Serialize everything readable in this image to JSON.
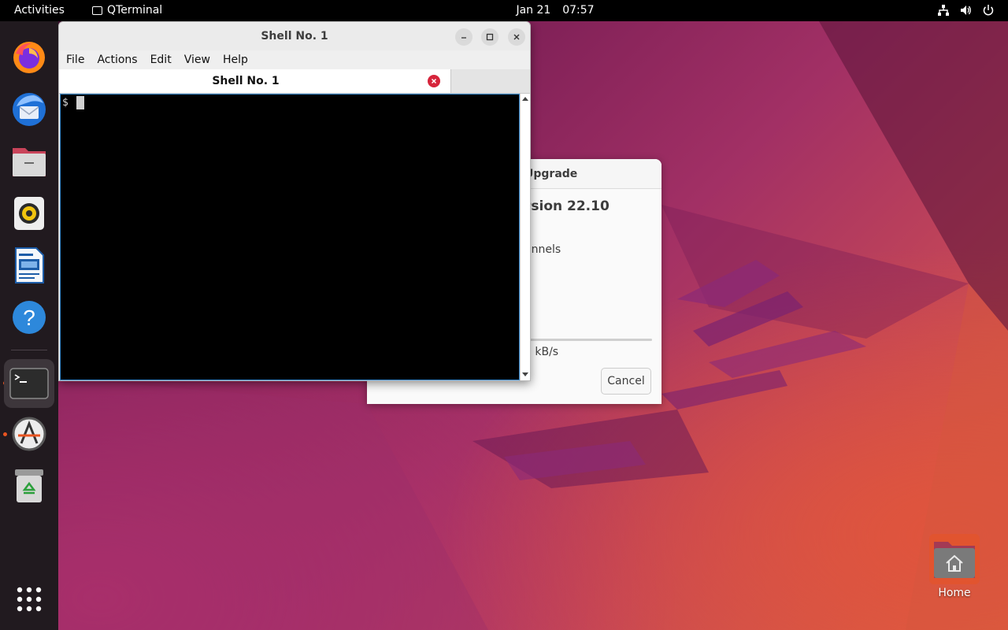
{
  "topbar": {
    "activities": "Activities",
    "app_name": "QTerminal",
    "date": "Jan 21",
    "time": "07:57",
    "tray_icons": [
      "network-icon",
      "volume-icon",
      "power-icon"
    ]
  },
  "dock": {
    "items": [
      {
        "name": "firefox",
        "icon": "firefox-icon",
        "running": false
      },
      {
        "name": "thunderbird",
        "icon": "thunderbird-icon",
        "running": false
      },
      {
        "name": "files",
        "icon": "folder-icon",
        "running": false
      },
      {
        "name": "rhythmbox",
        "icon": "speaker-icon",
        "running": false
      },
      {
        "name": "libreoffice-writer",
        "icon": "document-icon",
        "running": false
      },
      {
        "name": "help",
        "icon": "help-icon",
        "running": false
      },
      {
        "name": "terminal",
        "icon": "terminal-icon",
        "running": true,
        "active": true
      },
      {
        "name": "software-updater",
        "icon": "updater-icon",
        "running": true
      },
      {
        "name": "trash",
        "icon": "trash-icon",
        "running": false
      }
    ],
    "apps_grid_icon": "app-grid-icon"
  },
  "upgrade_dialog": {
    "title_fragment": "Upgrade",
    "version_fragment": "rsion 22.10",
    "channels_fragment": "annels",
    "r_fragment": "r",
    "speed_fragment": "0 kB/s",
    "cancel_label": "Cancel"
  },
  "qterminal": {
    "window_title": "Shell No. 1",
    "menu": [
      "File",
      "Actions",
      "Edit",
      "View",
      "Help"
    ],
    "tab_label": "Shell No. 1",
    "prompt": "$"
  },
  "desktop": {
    "home_label": "Home"
  },
  "colors": {
    "accent": "#e95420",
    "tab_close": "#d6243b",
    "terminal_bg": "#000000",
    "focus_border": "#3c8fd4"
  }
}
